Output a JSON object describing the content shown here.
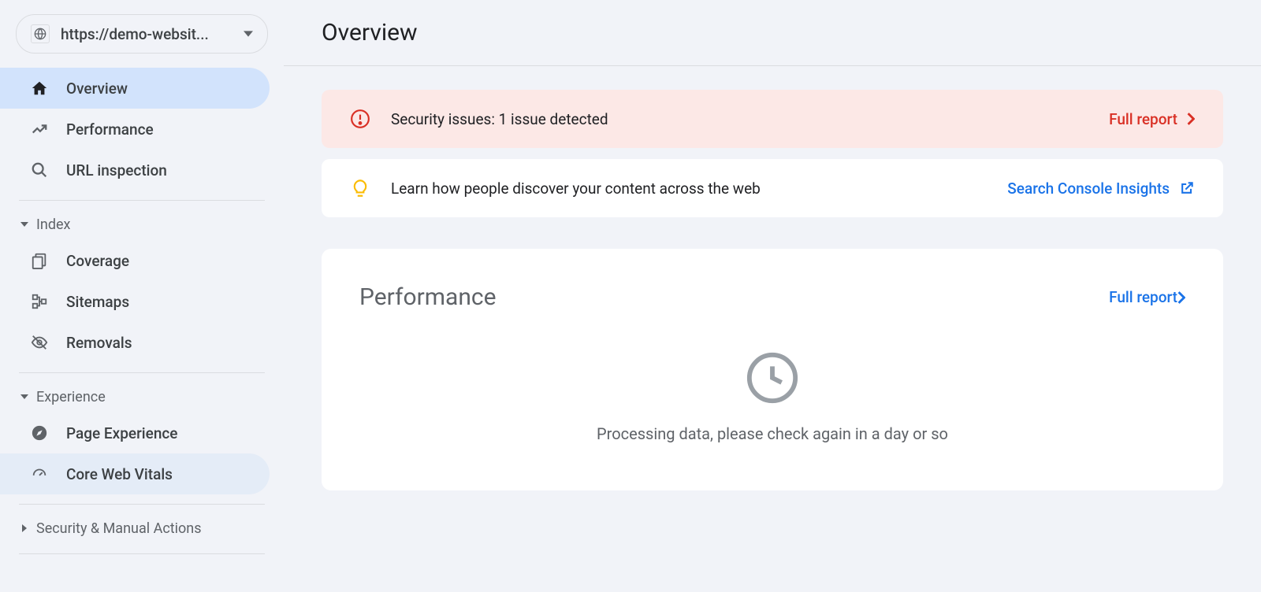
{
  "property": {
    "url_display": "https://demo-websit..."
  },
  "sidebar": {
    "primary": [
      {
        "label": "Overview"
      },
      {
        "label": "Performance"
      },
      {
        "label": "URL inspection"
      }
    ],
    "index": {
      "title": "Index",
      "items": [
        {
          "label": "Coverage"
        },
        {
          "label": "Sitemaps"
        },
        {
          "label": "Removals"
        }
      ]
    },
    "experience": {
      "title": "Experience",
      "items": [
        {
          "label": "Page Experience"
        },
        {
          "label": "Core Web Vitals"
        }
      ]
    },
    "security_section": {
      "title": "Security & Manual Actions"
    }
  },
  "page": {
    "title": "Overview"
  },
  "banners": {
    "security": {
      "text": "Security issues: 1 issue detected",
      "link": "Full report"
    },
    "insights": {
      "text": "Learn how people discover your content across the web",
      "link": "Search Console Insights"
    }
  },
  "performance_card": {
    "title": "Performance",
    "link": "Full report",
    "processing": "Processing data, please check again in a day or so"
  }
}
